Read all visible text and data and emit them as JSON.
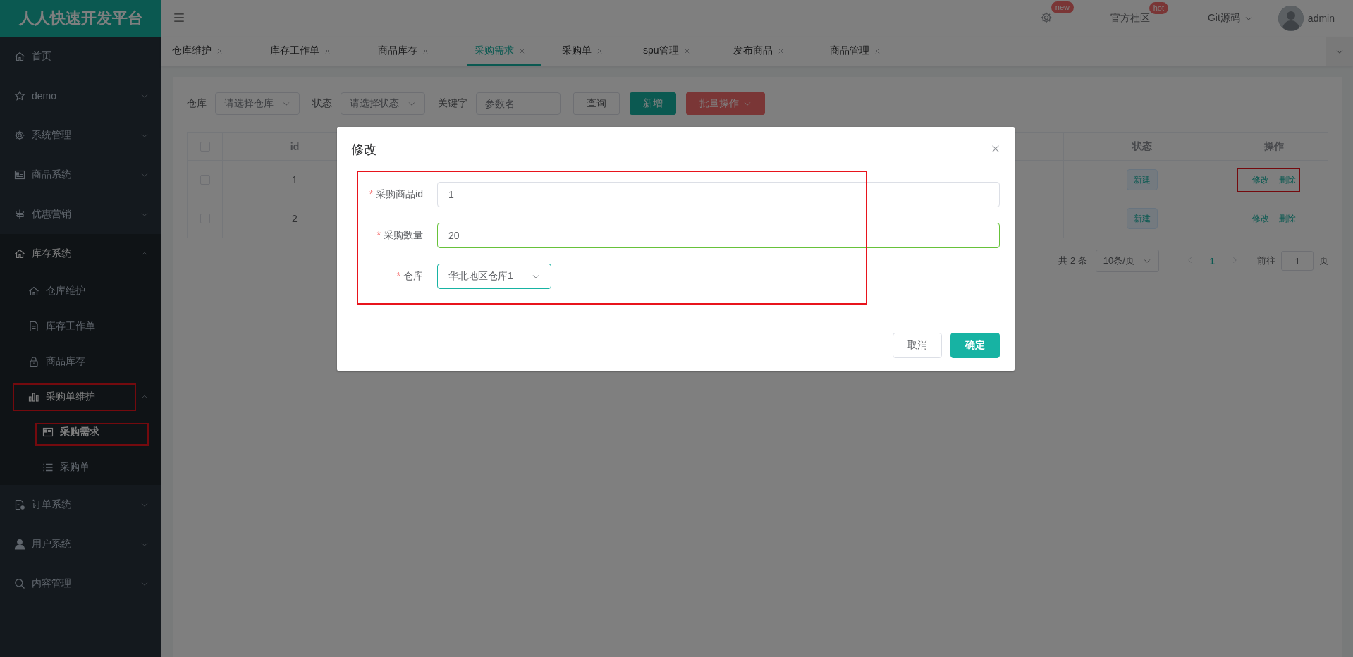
{
  "sidebar": {
    "logo": "人人快速开发平台",
    "items": [
      {
        "label": "首页",
        "selected": false
      },
      {
        "label": "demo",
        "selected": false,
        "expanded": false
      },
      {
        "label": "系统管理",
        "selected": false,
        "expanded": false
      },
      {
        "label": "商品系统",
        "selected": false,
        "expanded": false
      },
      {
        "label": "优惠营销",
        "selected": false,
        "expanded": false
      },
      {
        "label": "库存系统",
        "selected": false,
        "expanded": true,
        "children": [
          {
            "label": "仓库维护",
            "selected": false
          },
          {
            "label": "库存工作单",
            "selected": false
          },
          {
            "label": "商品库存",
            "selected": false
          },
          {
            "label": "采购单维护",
            "selected": false,
            "expanded": true,
            "highlighted": true,
            "children": [
              {
                "label": "采购需求",
                "selected": true,
                "highlighted": true
              },
              {
                "label": "采购单",
                "selected": false
              }
            ]
          }
        ]
      },
      {
        "label": "订单系统",
        "selected": false,
        "expanded": false
      },
      {
        "label": "用户系统",
        "selected": false,
        "expanded": false
      },
      {
        "label": "内容管理",
        "selected": false,
        "expanded": false
      }
    ]
  },
  "header": {
    "items": [
      {
        "kind": "settings",
        "badge": "new"
      },
      {
        "kind": "link",
        "label": "官方社区",
        "badge": "hot"
      },
      {
        "kind": "dropdown",
        "label": "Git源码"
      },
      {
        "kind": "user",
        "label": "admin"
      }
    ]
  },
  "tabs": [
    {
      "label": "仓库维护",
      "selected": false
    },
    {
      "label": "库存工作单",
      "selected": false
    },
    {
      "label": "商品库存",
      "selected": false
    },
    {
      "label": "采购需求",
      "selected": true
    },
    {
      "label": "采购单",
      "selected": false
    },
    {
      "label": "spu管理",
      "selected": false
    },
    {
      "label": "发布商品",
      "selected": false
    },
    {
      "label": "商品管理",
      "selected": false
    }
  ],
  "toolbar": {
    "fields": [
      {
        "kind": "select",
        "label": "仓库",
        "placeholder": "请选择仓库"
      },
      {
        "kind": "select",
        "label": "状态",
        "placeholder": "请选择状态"
      },
      {
        "kind": "input",
        "label": "关键字",
        "placeholder": "参数名"
      }
    ],
    "buttons": [
      {
        "kind": "plain",
        "label": "查询"
      },
      {
        "kind": "primary",
        "label": "新增"
      },
      {
        "kind": "danger-dropdown",
        "label": "批量操作"
      }
    ]
  },
  "table": {
    "select_all": false,
    "columns": [
      "id",
      "状态",
      "操作"
    ],
    "rows": [
      {
        "checked": false,
        "id": "1",
        "status": "新建",
        "actions": [
          "修改",
          "删除"
        ],
        "highlighted": true
      },
      {
        "checked": false,
        "id": "2",
        "status": "新建",
        "actions": [
          "修改",
          "删除"
        ],
        "highlighted": false
      }
    ]
  },
  "pagination": {
    "total": "共 2 条",
    "page_size": "10条/页",
    "pages": [
      {
        "label": "1",
        "selected": true
      }
    ],
    "goto_label": "前往",
    "goto_value": "1",
    "goto_suffix": "页"
  },
  "dialog": {
    "title": "修改",
    "highlighted": true,
    "fields": [
      {
        "kind": "input",
        "label": "采购商品id",
        "value": "1",
        "required_mark": "*",
        "valid": false,
        "focused": false
      },
      {
        "kind": "input",
        "label": "采购数量",
        "value": "20",
        "required_mark": "*",
        "valid": true,
        "focused": false
      },
      {
        "kind": "select",
        "label": "仓库",
        "value": "华北地区仓库1",
        "required_mark": "*",
        "valid": false,
        "focused": true
      }
    ],
    "buttons": [
      {
        "kind": "plain",
        "label": "取消"
      },
      {
        "kind": "primary",
        "label": "确定"
      }
    ]
  }
}
